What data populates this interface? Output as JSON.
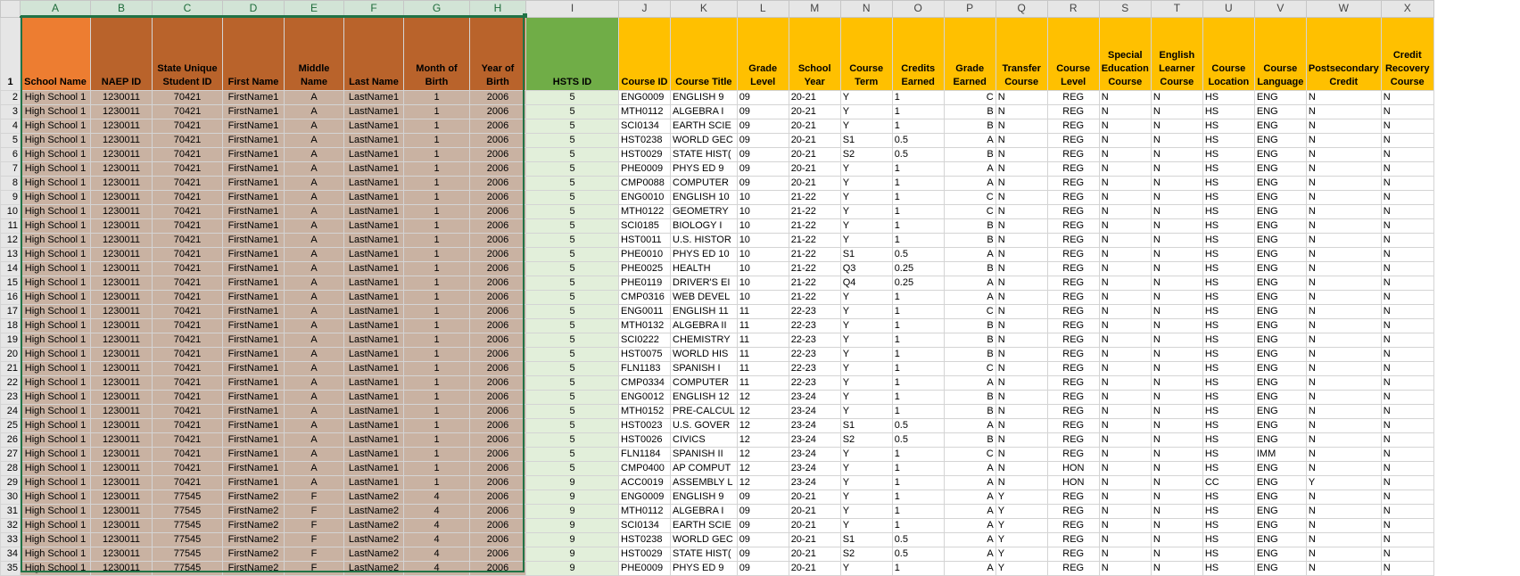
{
  "columns": [
    "A",
    "B",
    "C",
    "D",
    "E",
    "F",
    "G",
    "H",
    "I",
    "J",
    "K",
    "L",
    "M",
    "N",
    "O",
    "P",
    "Q",
    "R",
    "S",
    "T",
    "U",
    "V",
    "W",
    "X"
  ],
  "headers": [
    "School Name",
    "NAEP ID",
    "State Unique Student ID",
    "First Name",
    "Middle Name",
    "Last Name",
    "Month of Birth",
    "Year of Birth",
    "HSTS ID",
    "Course ID",
    "Course Title",
    "Grade Level",
    "School Year",
    "Course Term",
    "Credits Earned",
    "Grade Earned",
    "Transfer Course",
    "Course Level",
    "Special Education Course",
    "English Learner Course",
    "Course Location",
    "Course Language",
    "Postsecondary Credit",
    "Credit Recovery Course"
  ],
  "header_colors": {
    "orange": "#ed7d31",
    "brown": "#b9632b",
    "green": "#70ad47",
    "yellow": "#ffc000",
    "tan": "#c9b2a2",
    "light_green": "#e2efda",
    "selection": "#217346"
  },
  "rows": [
    [
      "2",
      "High School 1",
      "1230011",
      "70421",
      "FirstName1",
      "A",
      "LastName1",
      "1",
      "2006",
      "5",
      "ENG0009",
      "ENGLISH 9",
      "09",
      "20-21",
      "Y",
      "1",
      "C",
      "N",
      "REG",
      "N",
      "N",
      "HS",
      "ENG",
      "N",
      "N"
    ],
    [
      "3",
      "High School 1",
      "1230011",
      "70421",
      "FirstName1",
      "A",
      "LastName1",
      "1",
      "2006",
      "5",
      "MTH0112",
      "ALGEBRA I",
      "09",
      "20-21",
      "Y",
      "1",
      "B",
      "N",
      "REG",
      "N",
      "N",
      "HS",
      "ENG",
      "N",
      "N"
    ],
    [
      "4",
      "High School 1",
      "1230011",
      "70421",
      "FirstName1",
      "A",
      "LastName1",
      "1",
      "2006",
      "5",
      "SCI0134",
      "EARTH SCIE",
      "09",
      "20-21",
      "Y",
      "1",
      "B",
      "N",
      "REG",
      "N",
      "N",
      "HS",
      "ENG",
      "N",
      "N"
    ],
    [
      "5",
      "High School 1",
      "1230011",
      "70421",
      "FirstName1",
      "A",
      "LastName1",
      "1",
      "2006",
      "5",
      "HST0238",
      "WORLD GEC",
      "09",
      "20-21",
      "S1",
      "0.5",
      "A",
      "N",
      "REG",
      "N",
      "N",
      "HS",
      "ENG",
      "N",
      "N"
    ],
    [
      "6",
      "High School 1",
      "1230011",
      "70421",
      "FirstName1",
      "A",
      "LastName1",
      "1",
      "2006",
      "5",
      "HST0029",
      "STATE HIST(",
      "09",
      "20-21",
      "S2",
      "0.5",
      "B",
      "N",
      "REG",
      "N",
      "N",
      "HS",
      "ENG",
      "N",
      "N"
    ],
    [
      "7",
      "High School 1",
      "1230011",
      "70421",
      "FirstName1",
      "A",
      "LastName1",
      "1",
      "2006",
      "5",
      "PHE0009",
      "PHYS ED 9",
      "09",
      "20-21",
      "Y",
      "1",
      "A",
      "N",
      "REG",
      "N",
      "N",
      "HS",
      "ENG",
      "N",
      "N"
    ],
    [
      "8",
      "High School 1",
      "1230011",
      "70421",
      "FirstName1",
      "A",
      "LastName1",
      "1",
      "2006",
      "5",
      "CMP0088",
      "COMPUTER",
      "09",
      "20-21",
      "Y",
      "1",
      "A",
      "N",
      "REG",
      "N",
      "N",
      "HS",
      "ENG",
      "N",
      "N"
    ],
    [
      "9",
      "High School 1",
      "1230011",
      "70421",
      "FirstName1",
      "A",
      "LastName1",
      "1",
      "2006",
      "5",
      "ENG0010",
      "ENGLISH 10",
      "10",
      "21-22",
      "Y",
      "1",
      "C",
      "N",
      "REG",
      "N",
      "N",
      "HS",
      "ENG",
      "N",
      "N"
    ],
    [
      "10",
      "High School 1",
      "1230011",
      "70421",
      "FirstName1",
      "A",
      "LastName1",
      "1",
      "2006",
      "5",
      "MTH0122",
      "GEOMETRY",
      "10",
      "21-22",
      "Y",
      "1",
      "C",
      "N",
      "REG",
      "N",
      "N",
      "HS",
      "ENG",
      "N",
      "N"
    ],
    [
      "11",
      "High School 1",
      "1230011",
      "70421",
      "FirstName1",
      "A",
      "LastName1",
      "1",
      "2006",
      "5",
      "SCI0185",
      "BIOLOGY I",
      "10",
      "21-22",
      "Y",
      "1",
      "B",
      "N",
      "REG",
      "N",
      "N",
      "HS",
      "ENG",
      "N",
      "N"
    ],
    [
      "12",
      "High School 1",
      "1230011",
      "70421",
      "FirstName1",
      "A",
      "LastName1",
      "1",
      "2006",
      "5",
      "HST0011",
      "U.S. HISTOR",
      "10",
      "21-22",
      "Y",
      "1",
      "B",
      "N",
      "REG",
      "N",
      "N",
      "HS",
      "ENG",
      "N",
      "N"
    ],
    [
      "13",
      "High School 1",
      "1230011",
      "70421",
      "FirstName1",
      "A",
      "LastName1",
      "1",
      "2006",
      "5",
      "PHE0010",
      "PHYS ED 10",
      "10",
      "21-22",
      "S1",
      "0.5",
      "A",
      "N",
      "REG",
      "N",
      "N",
      "HS",
      "ENG",
      "N",
      "N"
    ],
    [
      "14",
      "High School 1",
      "1230011",
      "70421",
      "FirstName1",
      "A",
      "LastName1",
      "1",
      "2006",
      "5",
      "PHE0025",
      "HEALTH",
      "10",
      "21-22",
      "Q3",
      "0.25",
      "B",
      "N",
      "REG",
      "N",
      "N",
      "HS",
      "ENG",
      "N",
      "N"
    ],
    [
      "15",
      "High School 1",
      "1230011",
      "70421",
      "FirstName1",
      "A",
      "LastName1",
      "1",
      "2006",
      "5",
      "PHE0119",
      "DRIVER'S EI",
      "10",
      "21-22",
      "Q4",
      "0.25",
      "A",
      "N",
      "REG",
      "N",
      "N",
      "HS",
      "ENG",
      "N",
      "N"
    ],
    [
      "16",
      "High School 1",
      "1230011",
      "70421",
      "FirstName1",
      "A",
      "LastName1",
      "1",
      "2006",
      "5",
      "CMP0316",
      "WEB DEVEL",
      "10",
      "21-22",
      "Y",
      "1",
      "A",
      "N",
      "REG",
      "N",
      "N",
      "HS",
      "ENG",
      "N",
      "N"
    ],
    [
      "17",
      "High School 1",
      "1230011",
      "70421",
      "FirstName1",
      "A",
      "LastName1",
      "1",
      "2006",
      "5",
      "ENG0011",
      "ENGLISH 11",
      "11",
      "22-23",
      "Y",
      "1",
      "C",
      "N",
      "REG",
      "N",
      "N",
      "HS",
      "ENG",
      "N",
      "N"
    ],
    [
      "18",
      "High School 1",
      "1230011",
      "70421",
      "FirstName1",
      "A",
      "LastName1",
      "1",
      "2006",
      "5",
      "MTH0132",
      "ALGEBRA II",
      "11",
      "22-23",
      "Y",
      "1",
      "B",
      "N",
      "REG",
      "N",
      "N",
      "HS",
      "ENG",
      "N",
      "N"
    ],
    [
      "19",
      "High School 1",
      "1230011",
      "70421",
      "FirstName1",
      "A",
      "LastName1",
      "1",
      "2006",
      "5",
      "SCI0222",
      "CHEMISTRY",
      "11",
      "22-23",
      "Y",
      "1",
      "B",
      "N",
      "REG",
      "N",
      "N",
      "HS",
      "ENG",
      "N",
      "N"
    ],
    [
      "20",
      "High School 1",
      "1230011",
      "70421",
      "FirstName1",
      "A",
      "LastName1",
      "1",
      "2006",
      "5",
      "HST0075",
      "WORLD HIS",
      "11",
      "22-23",
      "Y",
      "1",
      "B",
      "N",
      "REG",
      "N",
      "N",
      "HS",
      "ENG",
      "N",
      "N"
    ],
    [
      "21",
      "High School 1",
      "1230011",
      "70421",
      "FirstName1",
      "A",
      "LastName1",
      "1",
      "2006",
      "5",
      "FLN1183",
      "SPANISH I",
      "11",
      "22-23",
      "Y",
      "1",
      "C",
      "N",
      "REG",
      "N",
      "N",
      "HS",
      "ENG",
      "N",
      "N"
    ],
    [
      "22",
      "High School 1",
      "1230011",
      "70421",
      "FirstName1",
      "A",
      "LastName1",
      "1",
      "2006",
      "5",
      "CMP0334",
      "COMPUTER",
      "11",
      "22-23",
      "Y",
      "1",
      "A",
      "N",
      "REG",
      "N",
      "N",
      "HS",
      "ENG",
      "N",
      "N"
    ],
    [
      "23",
      "High School 1",
      "1230011",
      "70421",
      "FirstName1",
      "A",
      "LastName1",
      "1",
      "2006",
      "5",
      "ENG0012",
      "ENGLISH 12",
      "12",
      "23-24",
      "Y",
      "1",
      "B",
      "N",
      "REG",
      "N",
      "N",
      "HS",
      "ENG",
      "N",
      "N"
    ],
    [
      "24",
      "High School 1",
      "1230011",
      "70421",
      "FirstName1",
      "A",
      "LastName1",
      "1",
      "2006",
      "5",
      "MTH0152",
      "PRE-CALCUL",
      "12",
      "23-24",
      "Y",
      "1",
      "B",
      "N",
      "REG",
      "N",
      "N",
      "HS",
      "ENG",
      "N",
      "N"
    ],
    [
      "25",
      "High School 1",
      "1230011",
      "70421",
      "FirstName1",
      "A",
      "LastName1",
      "1",
      "2006",
      "5",
      "HST0023",
      "U.S. GOVER",
      "12",
      "23-24",
      "S1",
      "0.5",
      "A",
      "N",
      "REG",
      "N",
      "N",
      "HS",
      "ENG",
      "N",
      "N"
    ],
    [
      "26",
      "High School 1",
      "1230011",
      "70421",
      "FirstName1",
      "A",
      "LastName1",
      "1",
      "2006",
      "5",
      "HST0026",
      "CIVICS",
      "12",
      "23-24",
      "S2",
      "0.5",
      "B",
      "N",
      "REG",
      "N",
      "N",
      "HS",
      "ENG",
      "N",
      "N"
    ],
    [
      "27",
      "High School 1",
      "1230011",
      "70421",
      "FirstName1",
      "A",
      "LastName1",
      "1",
      "2006",
      "5",
      "FLN1184",
      "SPANISH II",
      "12",
      "23-24",
      "Y",
      "1",
      "C",
      "N",
      "REG",
      "N",
      "N",
      "HS",
      "IMM",
      "N",
      "N"
    ],
    [
      "28",
      "High School 1",
      "1230011",
      "70421",
      "FirstName1",
      "A",
      "LastName1",
      "1",
      "2006",
      "5",
      "CMP0400",
      "AP COMPUT",
      "12",
      "23-24",
      "Y",
      "1",
      "A",
      "N",
      "HON",
      "N",
      "N",
      "HS",
      "ENG",
      "N",
      "N"
    ],
    [
      "29",
      "High School 1",
      "1230011",
      "70421",
      "FirstName1",
      "A",
      "LastName1",
      "1",
      "2006",
      "9",
      "ACC0019",
      "ASSEMBLY L",
      "12",
      "23-24",
      "Y",
      "1",
      "A",
      "N",
      "HON",
      "N",
      "N",
      "CC",
      "ENG",
      "Y",
      "N"
    ],
    [
      "30",
      "High School 1",
      "1230011",
      "77545",
      "FirstName2",
      "F",
      "LastName2",
      "4",
      "2006",
      "9",
      "ENG0009",
      "ENGLISH 9",
      "09",
      "20-21",
      "Y",
      "1",
      "A",
      "Y",
      "REG",
      "N",
      "N",
      "HS",
      "ENG",
      "N",
      "N"
    ],
    [
      "31",
      "High School 1",
      "1230011",
      "77545",
      "FirstName2",
      "F",
      "LastName2",
      "4",
      "2006",
      "9",
      "MTH0112",
      "ALGEBRA I",
      "09",
      "20-21",
      "Y",
      "1",
      "A",
      "Y",
      "REG",
      "N",
      "N",
      "HS",
      "ENG",
      "N",
      "N"
    ],
    [
      "32",
      "High School 1",
      "1230011",
      "77545",
      "FirstName2",
      "F",
      "LastName2",
      "4",
      "2006",
      "9",
      "SCI0134",
      "EARTH SCIE",
      "09",
      "20-21",
      "Y",
      "1",
      "A",
      "Y",
      "REG",
      "N",
      "N",
      "HS",
      "ENG",
      "N",
      "N"
    ],
    [
      "33",
      "High School 1",
      "1230011",
      "77545",
      "FirstName2",
      "F",
      "LastName2",
      "4",
      "2006",
      "9",
      "HST0238",
      "WORLD GEC",
      "09",
      "20-21",
      "S1",
      "0.5",
      "A",
      "Y",
      "REG",
      "N",
      "N",
      "HS",
      "ENG",
      "N",
      "N"
    ],
    [
      "34",
      "High School 1",
      "1230011",
      "77545",
      "FirstName2",
      "F",
      "LastName2",
      "4",
      "2006",
      "9",
      "HST0029",
      "STATE HIST(",
      "09",
      "20-21",
      "S2",
      "0.5",
      "A",
      "Y",
      "REG",
      "N",
      "N",
      "HS",
      "ENG",
      "N",
      "N"
    ],
    [
      "35",
      "High School 1",
      "1230011",
      "77545",
      "FirstName2",
      "F",
      "LastName2",
      "4",
      "2006",
      "9",
      "PHE0009",
      "PHYS ED 9",
      "09",
      "20-21",
      "Y",
      "1",
      "A",
      "Y",
      "REG",
      "N",
      "N",
      "HS",
      "ENG",
      "N",
      "N"
    ]
  ]
}
